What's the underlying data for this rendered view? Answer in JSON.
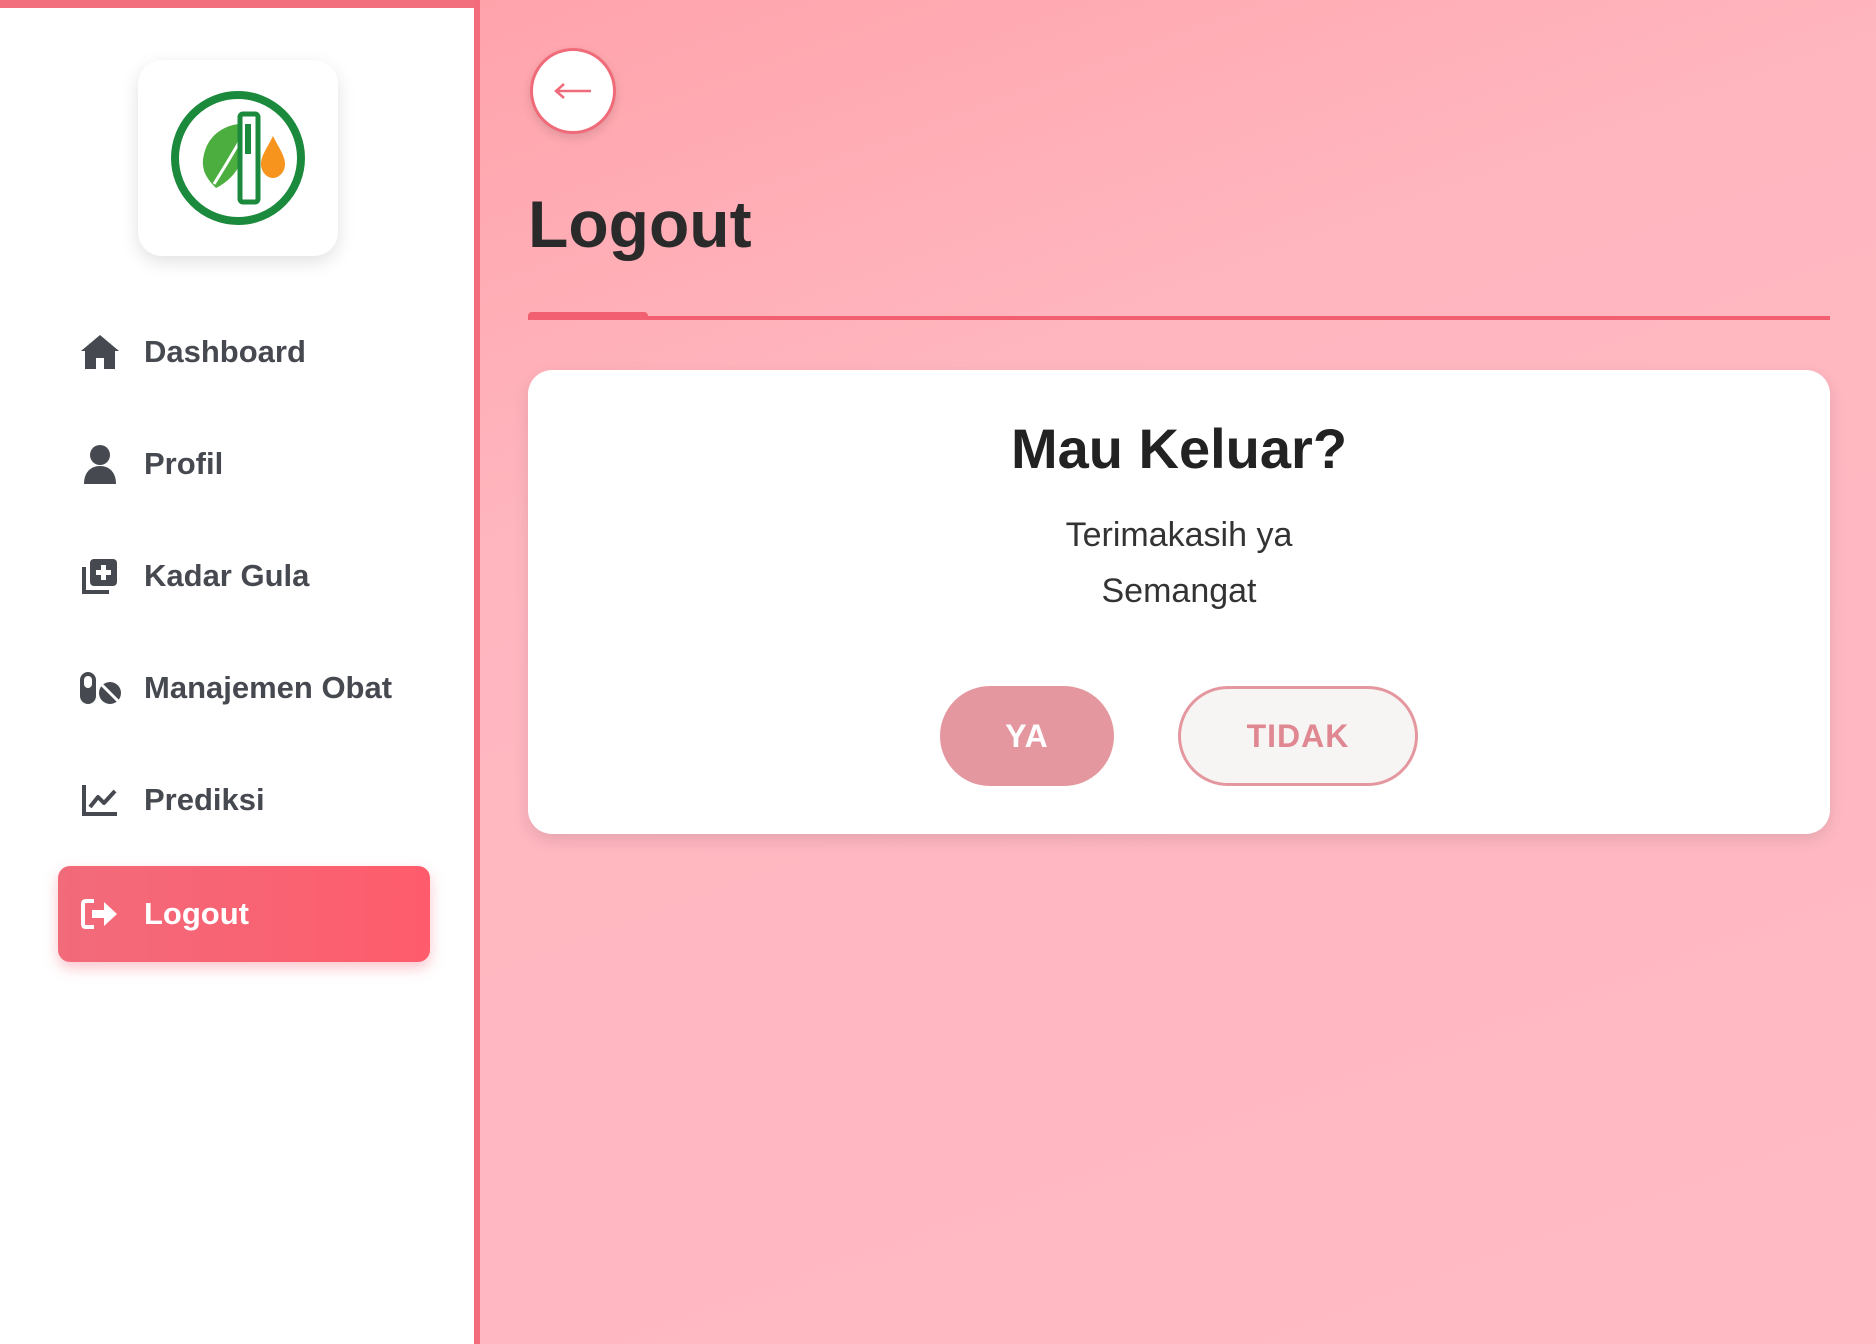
{
  "sidebar": {
    "items": [
      {
        "label": "Dashboard",
        "icon": "home-icon"
      },
      {
        "label": "Profil",
        "icon": "user-icon"
      },
      {
        "label": "Kadar Gula",
        "icon": "medical-record-icon"
      },
      {
        "label": "Manajemen Obat",
        "icon": "pills-icon"
      },
      {
        "label": "Prediksi",
        "icon": "chart-line-icon"
      },
      {
        "label": "Logout",
        "icon": "sign-out-icon",
        "active": true
      }
    ]
  },
  "header": {
    "back_label": "←",
    "title": "Logout"
  },
  "dialog": {
    "title": "Mau Keluar?",
    "line1": "Terimakasih ya",
    "line2": "Semangat",
    "yes_label": "YA",
    "no_label": "TIDAK"
  },
  "colors": {
    "accent": "#f25f70",
    "yes_button": "#e4979e",
    "background": "#ffb6bf"
  }
}
